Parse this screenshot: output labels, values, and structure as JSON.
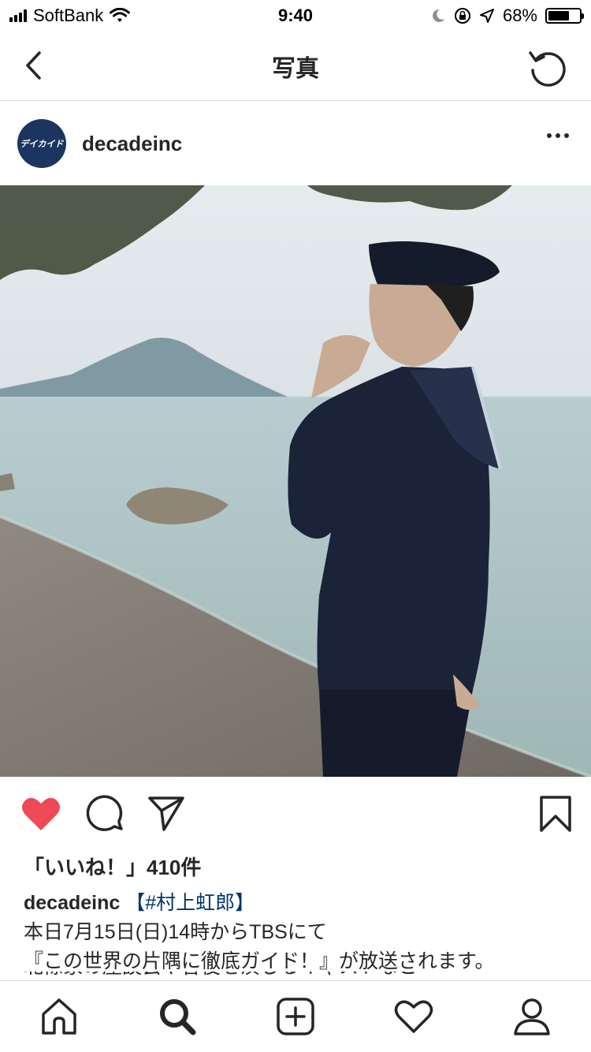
{
  "status_bar": {
    "carrier": "SoftBank",
    "time": "9:40",
    "battery": "68%",
    "battery_level": 0.68
  },
  "nav": {
    "title": "写真",
    "back_icon": "chevron-left-icon",
    "refresh_icon": "refresh-icon"
  },
  "post": {
    "username": "decadeinc",
    "avatar_text": "デイカイド",
    "likes_text": "「いいね！」410件",
    "caption": {
      "username": "decadeinc",
      "hashtag": "【#村上虹郎】",
      "line1": "本日7月15日(日)14時からTBSにて",
      "line2": "『この世界の片隅に徹底ガイド！』が放送されます。",
      "line3_partial": "北條家の座談会や各役を演じるキャストなど"
    }
  },
  "actions": {
    "like_icon": "heart-filled-icon",
    "comment_icon": "comment-icon",
    "share_icon": "paper-plane-icon",
    "save_icon": "bookmark-icon",
    "like_color": "#ed4956"
  },
  "tabbar": {
    "items": [
      "home-icon",
      "search-icon",
      "add-post-icon",
      "activity-heart-icon",
      "profile-icon"
    ]
  }
}
